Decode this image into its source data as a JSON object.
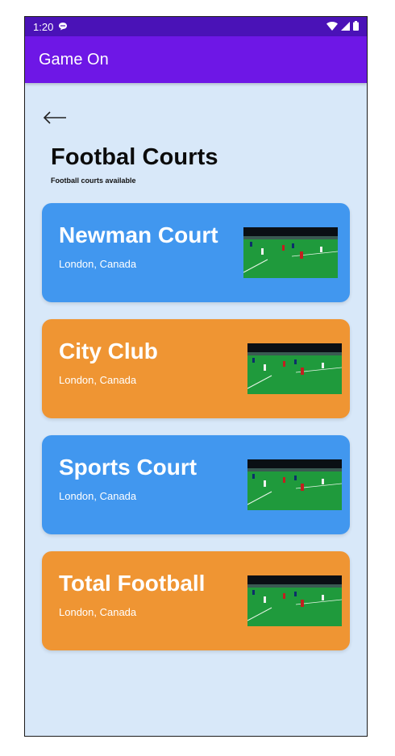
{
  "status_bar": {
    "time": "1:20"
  },
  "app_bar": {
    "title": "Game On"
  },
  "page": {
    "title": "Footbal Courts",
    "subtitle": "Football courts available"
  },
  "courts": [
    {
      "name": "Newman Court",
      "location": "London, Canada"
    },
    {
      "name": "City Club",
      "location": "London, Canada"
    },
    {
      "name": "Sports Court",
      "location": "London, Canada"
    },
    {
      "name": "Total Football",
      "location": "London, Canada"
    }
  ],
  "colors": {
    "status_bar": "#4a12b7",
    "app_bar": "#6e17e6",
    "background": "#d8e8f9",
    "card_blue": "#4197ef",
    "card_orange": "#ef9533"
  },
  "icons": {
    "status": [
      "chat-bubble-icon",
      "wifi-icon",
      "signal-icon",
      "battery-icon"
    ],
    "back": "back-arrow-icon",
    "thumbnail": "football-pitch-photo"
  }
}
